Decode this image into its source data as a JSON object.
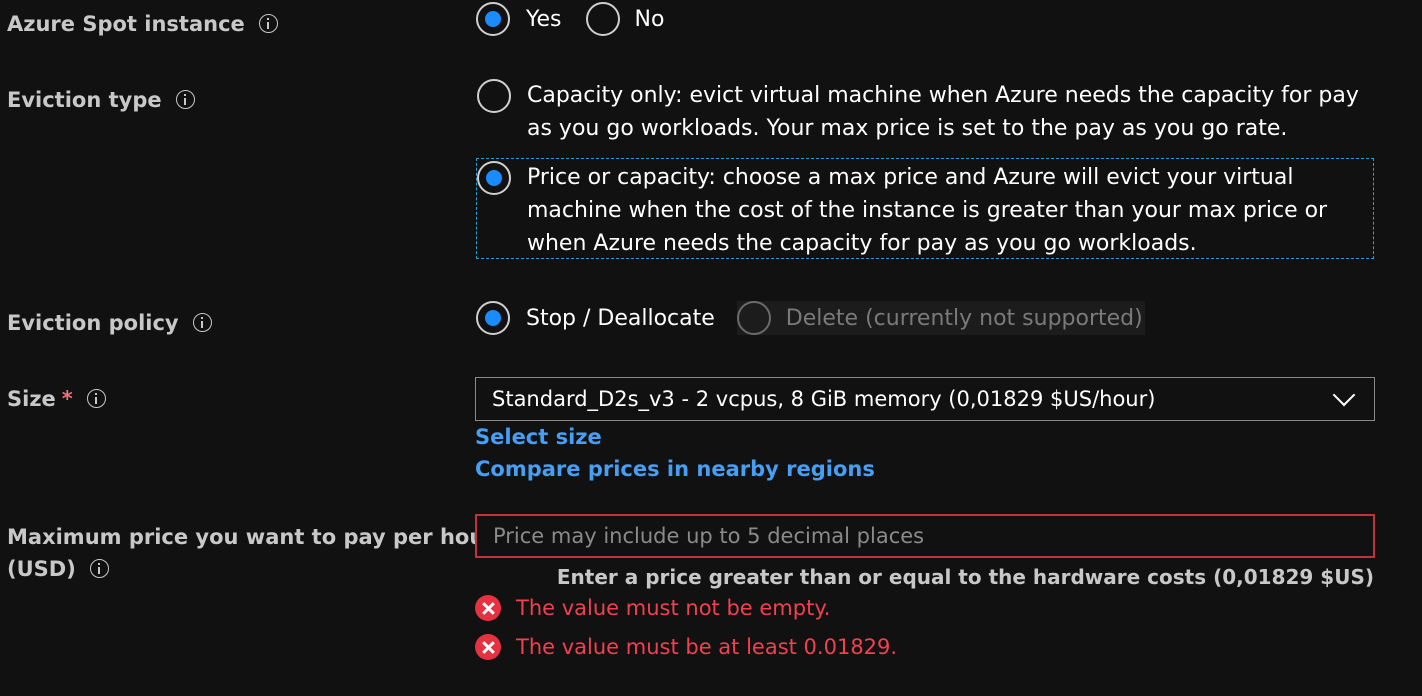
{
  "spot": {
    "label": "Azure Spot instance",
    "options": [
      {
        "label": "Yes",
        "checked": true
      },
      {
        "label": "No",
        "checked": false
      }
    ]
  },
  "eviction_type": {
    "label": "Eviction type",
    "options": [
      {
        "label": "Capacity only: evict virtual machine when Azure needs the capacity for pay as you go workloads. Your max price is set to the pay as you go rate.",
        "checked": false
      },
      {
        "label": "Price or capacity: choose a max price and Azure will evict your virtual machine when the cost of the instance is greater than your max price or when Azure needs the capacity for pay as you go workloads.",
        "checked": true
      }
    ]
  },
  "eviction_policy": {
    "label": "Eviction policy",
    "options": [
      {
        "label": "Stop / Deallocate",
        "checked": true
      },
      {
        "label": "Delete (currently not supported)",
        "checked": false,
        "disabled": true
      }
    ]
  },
  "size": {
    "label": "Size",
    "required_mark": "*",
    "selected": "Standard_D2s_v3 - 2 vcpus, 8 GiB memory (0,01829 $US/hour)",
    "select_link": "Select size",
    "compare_link": "Compare prices in nearby regions"
  },
  "max_price": {
    "label_line1": "Maximum price you want to pay per hour",
    "label_line2": "(USD)",
    "value": "",
    "placeholder": "Price may include up to 5 decimal places",
    "hint": "Enter a price greater than or equal to the hardware costs (0,01829 $US)",
    "errors": [
      "The value must not be empty.",
      "The value must be at least 0.01829."
    ]
  },
  "colors": {
    "background": "#111111",
    "accent": "#1a8cff",
    "link": "#479ef5",
    "error": "#e83140"
  }
}
